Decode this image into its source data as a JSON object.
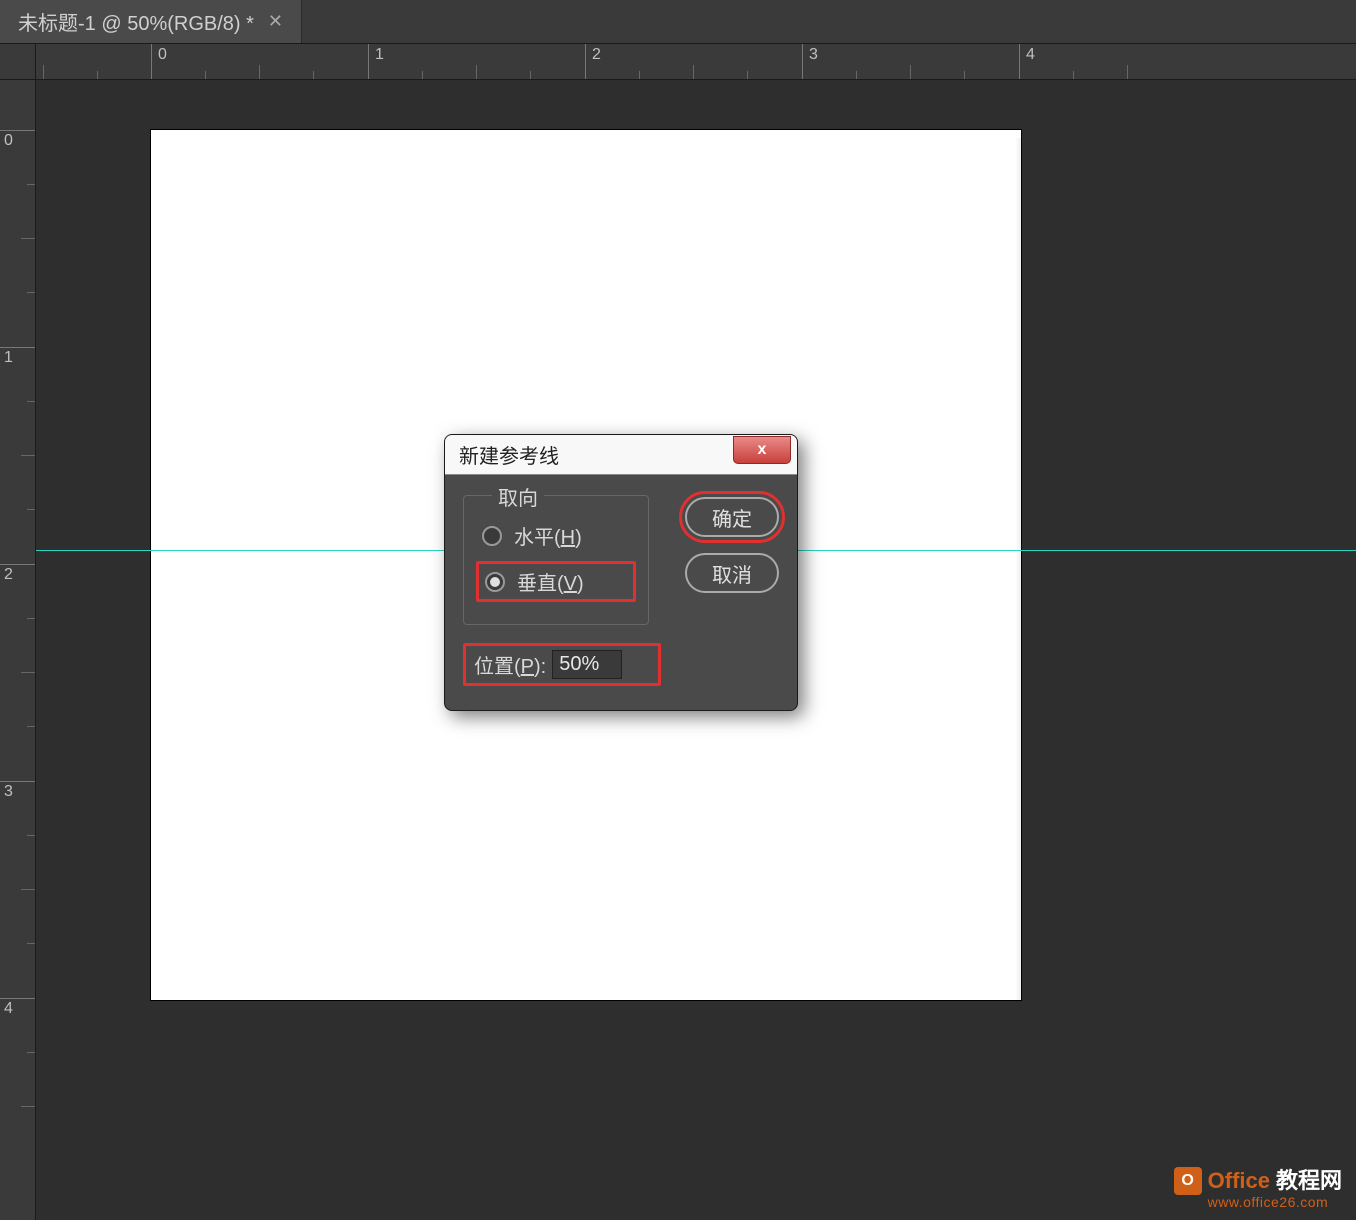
{
  "tab": {
    "title": "未标题-1 @ 50%(RGB/8) *"
  },
  "rulers": {
    "h_labels": [
      "0",
      "1",
      "2",
      "3",
      "4"
    ],
    "v_labels": [
      "0",
      "1",
      "2",
      "3",
      "4"
    ]
  },
  "dialog": {
    "title": "新建参考线",
    "close_x": "x",
    "orientation": {
      "legend": "取向",
      "horizontal_label": "水平(",
      "horizontal_key": "H",
      "horizontal_suffix": ")",
      "vertical_label": "垂直(",
      "vertical_key": "V",
      "vertical_suffix": ")",
      "selected": "vertical"
    },
    "position": {
      "label_pre": "位置(",
      "label_key": "P",
      "label_suf": "):",
      "value": "50%"
    },
    "buttons": {
      "ok": "确定",
      "cancel": "取消"
    }
  },
  "watermark": {
    "brand_a": "Office",
    "brand_b": "教程网",
    "url": "www.office26.com",
    "icon_letter": "O"
  }
}
